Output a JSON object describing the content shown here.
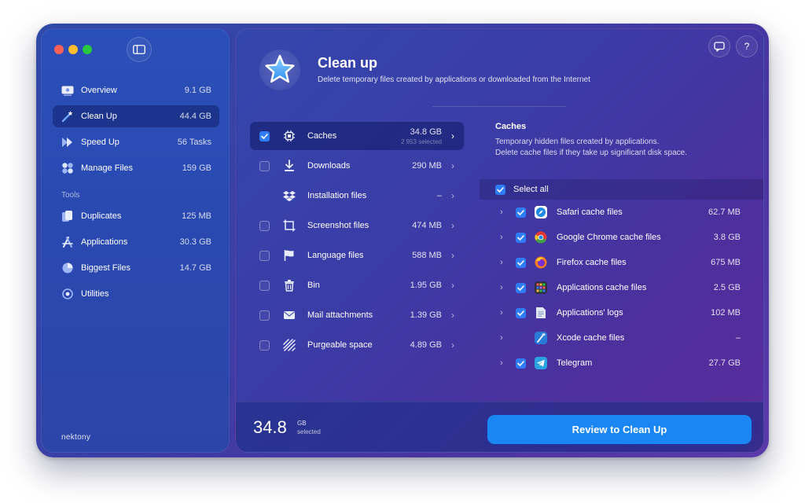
{
  "sidebar": {
    "items": [
      {
        "label": "Overview",
        "value": "9.1 GB",
        "icon": "overview-icon"
      },
      {
        "label": "Clean Up",
        "value": "44.4 GB",
        "icon": "magic-wand-icon",
        "active": true
      },
      {
        "label": "Speed Up",
        "value": "56 Tasks",
        "icon": "speed-up-icon"
      },
      {
        "label": "Manage Files",
        "value": "159 GB",
        "icon": "manage-files-icon"
      }
    ],
    "tools_header": "Tools",
    "tools": [
      {
        "label": "Duplicates",
        "value": "125 MB",
        "icon": "duplicates-icon"
      },
      {
        "label": "Applications",
        "value": "30.3 GB",
        "icon": "applications-icon"
      },
      {
        "label": "Biggest Files",
        "value": "14.7 GB",
        "icon": "pie-chart-icon"
      },
      {
        "label": "Utilities",
        "value": "",
        "icon": "utilities-icon"
      }
    ],
    "brand": "nektony"
  },
  "header": {
    "title": "Clean up",
    "subtitle": "Delete temporary files created by applications or downloaded from the Internet"
  },
  "categories": [
    {
      "label": "Caches",
      "size": "34.8 GB",
      "sub": "2 953 selected",
      "checked": true,
      "active": true,
      "icon": "chip-icon"
    },
    {
      "label": "Downloads",
      "size": "290 MB",
      "sub": "",
      "checked": false,
      "icon": "download-icon"
    },
    {
      "label": "Installation files",
      "size": "–",
      "sub": "",
      "checked": false,
      "no_checkbox": true,
      "icon": "dropbox-icon"
    },
    {
      "label": "Screenshot files",
      "size": "474 MB",
      "sub": "",
      "checked": false,
      "icon": "screenshot-icon"
    },
    {
      "label": "Language files",
      "size": "588 MB",
      "sub": "",
      "checked": false,
      "icon": "flag-icon"
    },
    {
      "label": "Bin",
      "size": "1.95 GB",
      "sub": "",
      "checked": false,
      "icon": "trash-icon"
    },
    {
      "label": "Mail attachments",
      "size": "1.39 GB",
      "sub": "",
      "checked": false,
      "icon": "mail-icon"
    },
    {
      "label": "Purgeable space",
      "size": "4.89 GB",
      "sub": "",
      "checked": false,
      "icon": "purgeable-icon"
    }
  ],
  "detail": {
    "title": "Caches",
    "desc1": "Temporary hidden files created by applications.",
    "desc2": "Delete cache files if they take up significant disk space.",
    "select_all": "Select all",
    "rows": [
      {
        "label": "Safari cache files",
        "size": "62.7 MB",
        "checked": true,
        "icon": "safari-icon",
        "color": "#1e88e5"
      },
      {
        "label": "Google Chrome cache files",
        "size": "3.8 GB",
        "checked": true,
        "icon": "chrome-icon",
        "color": "#e53935"
      },
      {
        "label": "Firefox cache files",
        "size": "675 MB",
        "checked": true,
        "icon": "firefox-icon",
        "color": "#ff7b1a"
      },
      {
        "label": "Applications cache files",
        "size": "2.5 GB",
        "checked": true,
        "icon": "app-grid-icon",
        "color": "#3a3a4a"
      },
      {
        "label": "Applications' logs",
        "size": "102 MB",
        "checked": true,
        "icon": "log-file-icon",
        "color": "#dfe7f5"
      },
      {
        "label": "Xcode cache files",
        "size": "–",
        "checked": false,
        "no_checkbox": true,
        "icon": "xcode-icon",
        "color": "#2a7ad8"
      },
      {
        "label": "Telegram",
        "size": "27.7 GB",
        "checked": true,
        "icon": "telegram-icon",
        "color": "#2aa3e0"
      }
    ]
  },
  "footer": {
    "total": "34.8",
    "unit": "GB",
    "selected": "selected",
    "review_button": "Review to Clean Up"
  },
  "top_buttons": {
    "feedback_icon": "chat-bubble-icon",
    "help_label": "?"
  },
  "colors": {
    "accent": "#1a86f4",
    "checkbox": "#2f7cf6"
  }
}
